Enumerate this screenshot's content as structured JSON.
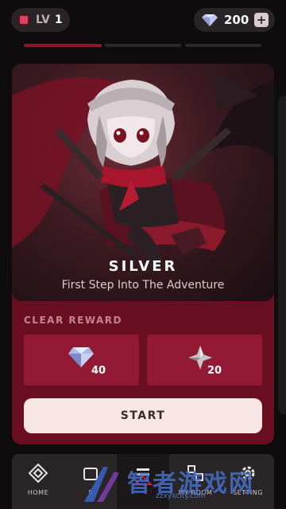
{
  "header": {
    "level_label": "LV",
    "level_value": "1",
    "gem_count": "200",
    "plus_label": "+"
  },
  "card": {
    "title": "SILVER",
    "subtitle": "First Step Into The Adventure",
    "reward_label": "CLEAR REWARD",
    "rewards": [
      {
        "icon": "diamond-icon",
        "value": "40"
      },
      {
        "icon": "star-shard-icon",
        "value": "20"
      }
    ],
    "start_label": "START"
  },
  "nav": {
    "items": [
      {
        "label": "HOME",
        "icon": "home-diamond-icon"
      },
      {
        "label": "S",
        "icon": "shop-icon"
      },
      {
        "label": "",
        "icon": "stage-icon"
      },
      {
        "label": "MY ROOM",
        "icon": "room-icon"
      },
      {
        "label": "SETTING",
        "icon": "gear-icon"
      }
    ]
  },
  "watermark": {
    "text": "智者游戏网",
    "url": "zzxyxcity.com"
  },
  "colors": {
    "accent": "#931a34",
    "card_bg": "#6a0e22",
    "level_icon": "#e04160",
    "button_bg": "#f7e6e3"
  }
}
